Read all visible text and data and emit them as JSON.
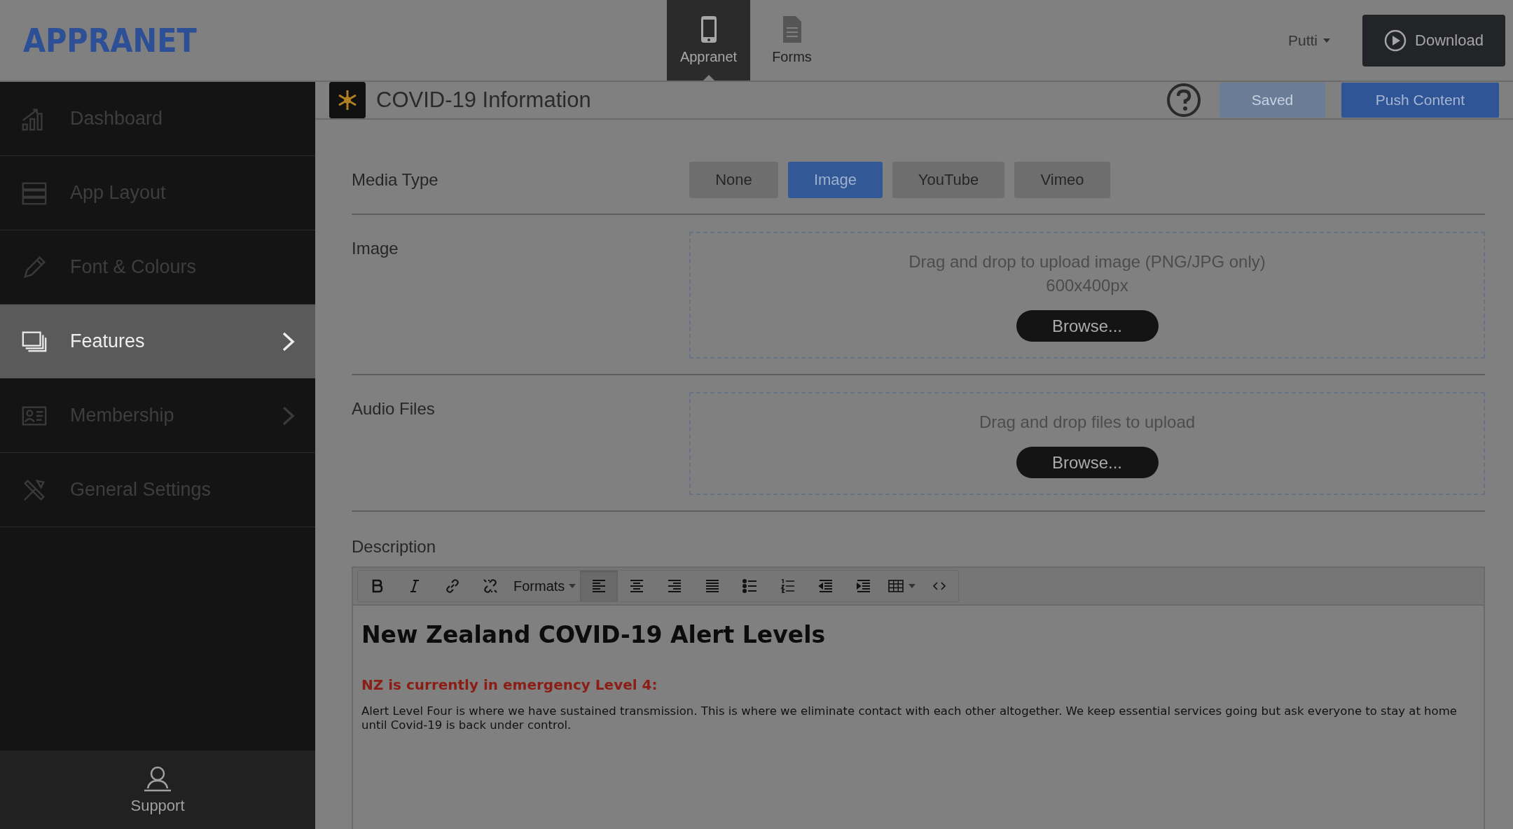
{
  "header": {
    "logo": "APPRANET",
    "tabs": [
      {
        "label": "Appranet",
        "kind": "phone",
        "selected": true
      },
      {
        "label": "Forms",
        "kind": "document",
        "selected": false
      }
    ],
    "user_menu": "Putti",
    "download_button": "Download"
  },
  "sidebar": {
    "items": [
      {
        "label": "Dashboard",
        "kind": "chart",
        "selected": false,
        "has_submenu": false
      },
      {
        "label": "App Layout",
        "kind": "layout",
        "selected": false,
        "has_submenu": false
      },
      {
        "label": "Font & Colours",
        "kind": "pencil",
        "selected": false,
        "has_submenu": false
      },
      {
        "label": "Features",
        "kind": "stack",
        "selected": true,
        "has_submenu": true
      },
      {
        "label": "Membership",
        "kind": "card",
        "selected": false,
        "has_submenu": true
      },
      {
        "label": "General Settings",
        "kind": "tools",
        "selected": false,
        "has_submenu": false
      }
    ],
    "support": "Support"
  },
  "page": {
    "title": "COVID-19 Information",
    "saved_button": "Saved",
    "push_button": "Push Content"
  },
  "media_type": {
    "label": "Media Type",
    "options": [
      {
        "label": "None",
        "selected": false
      },
      {
        "label": "Image",
        "selected": true
      },
      {
        "label": "YouTube",
        "selected": false
      },
      {
        "label": "Vimeo",
        "selected": false
      }
    ]
  },
  "uploads": [
    {
      "label": "Image",
      "hint": "Drag and drop to upload image (PNG/JPG only)",
      "size_hint": "600x400px",
      "button": "Browse..."
    },
    {
      "label": "Audio Files",
      "hint": "Drag and drop files to upload",
      "button": "Browse..."
    }
  ],
  "description": {
    "label": "Description",
    "toolbar": [
      {
        "kind": "bold",
        "selected": false
      },
      {
        "kind": "italic",
        "selected": false
      },
      {
        "kind": "link",
        "selected": false
      },
      {
        "kind": "unlink",
        "selected": false
      },
      {
        "kind": "formats",
        "label": "Formats",
        "selected": false
      },
      {
        "kind": "align-left",
        "selected": true
      },
      {
        "kind": "align-center",
        "selected": false
      },
      {
        "kind": "align-right",
        "selected": false
      },
      {
        "kind": "justify",
        "selected": false
      },
      {
        "kind": "bullets",
        "selected": false
      },
      {
        "kind": "numbers",
        "selected": false
      },
      {
        "kind": "outdent",
        "selected": false
      },
      {
        "kind": "indent",
        "selected": false
      },
      {
        "kind": "table",
        "selected": false
      },
      {
        "kind": "code",
        "selected": false
      }
    ],
    "heading": "New Zealand COVID-19 Alert Levels",
    "alert": "NZ is currently in emergency Level 4:",
    "body": "Alert Level Four is where we have sustained transmission. This is where we eliminate contact with each other altogether. We keep essential services going but ask everyone to stay at home until Covid-19 is back under control."
  }
}
